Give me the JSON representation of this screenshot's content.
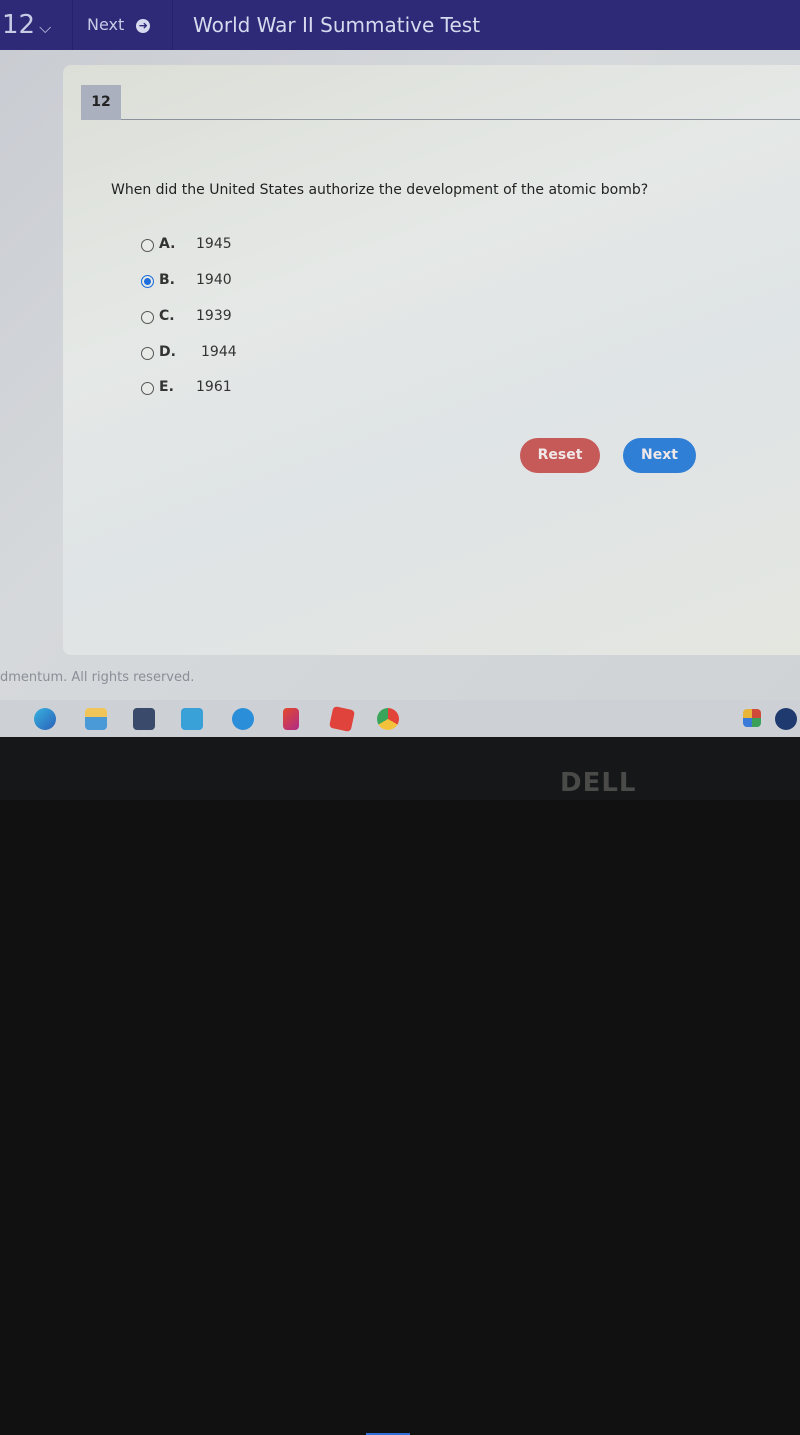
{
  "topbar": {
    "question_number": "12",
    "question_chevron": "chevron-down-icon",
    "next_label": "Next",
    "next_icon": "arrow-circle-right-icon",
    "title": "World War II Summative Test"
  },
  "question": {
    "number": "12",
    "text": "When did the United States authorize the development of the atomic bomb?",
    "options": [
      {
        "letter": "A.",
        "value": "1945",
        "selected": false
      },
      {
        "letter": "B.",
        "value": "1940",
        "selected": true
      },
      {
        "letter": "C.",
        "value": "1939",
        "selected": false
      },
      {
        "letter": "D.",
        "value": "1944",
        "selected": false
      },
      {
        "letter": "E.",
        "value": "1961",
        "selected": false
      }
    ]
  },
  "buttons": {
    "reset_label": "Reset",
    "next_label": "Next",
    "reset_color": "#c55a58",
    "next_color": "#2f7fd6"
  },
  "footer": {
    "copyright": "dmentum. All rights reserved."
  },
  "taskbar": {
    "icons": [
      "edge-icon",
      "file-explorer-icon",
      "store-icon",
      "mail-icon",
      "tool-icon",
      "office-icon",
      "roblox-icon",
      "chrome-icon",
      "windows-apps-icon",
      "steam-icon"
    ]
  },
  "bezel": {
    "brand": "DELL"
  }
}
